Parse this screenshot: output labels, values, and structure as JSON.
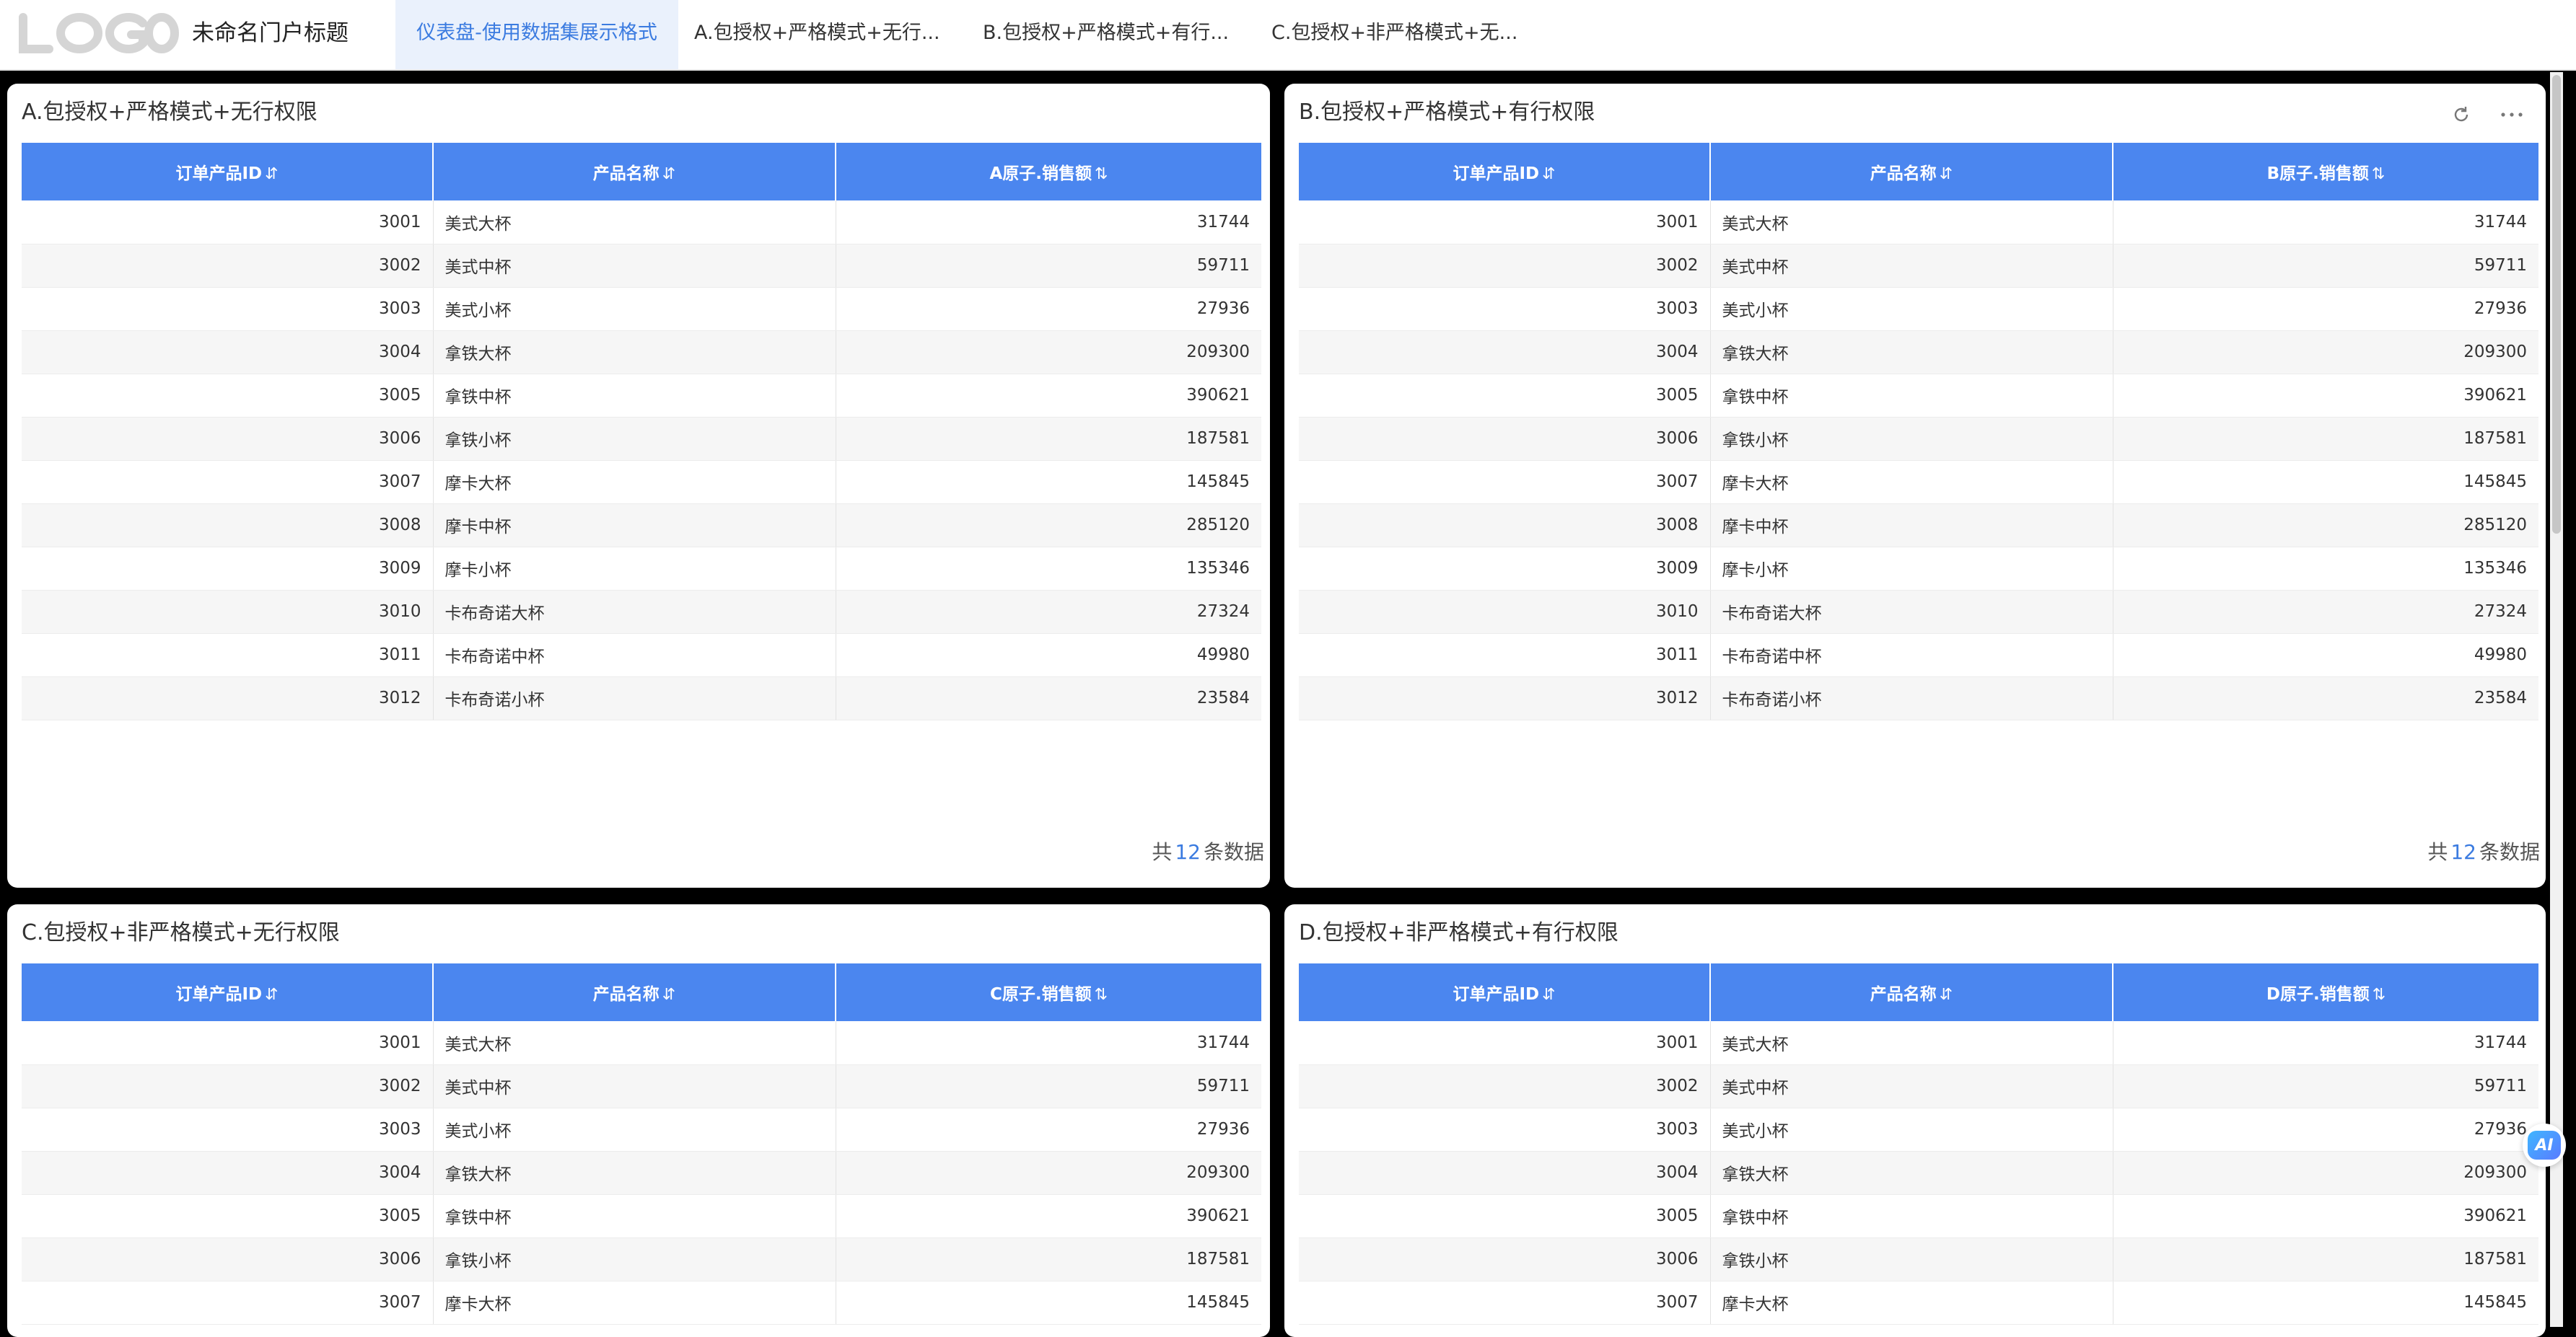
{
  "header": {
    "logo_text": "LOGO",
    "portal_title": "未命名门户标题",
    "tabs": [
      {
        "label": "仪表盘-使用数据集展示格式",
        "active": true
      },
      {
        "label": "A.包授权+严格模式+无行...",
        "active": false
      },
      {
        "label": "B.包授权+严格模式+有行...",
        "active": false
      },
      {
        "label": "C.包授权+非严格模式+无...",
        "active": false
      }
    ]
  },
  "colors": {
    "accent": "#3b7be0",
    "table_header": "#4b86ef",
    "tab_active_bg": "#eaf1fc"
  },
  "panels": {
    "a": {
      "title": "A.包授权+严格模式+无行权限",
      "columns": [
        "订单产品ID",
        "产品名称",
        "A原子.销售额"
      ],
      "footer": {
        "prefix": "共",
        "count": "12",
        "suffix": "条数据"
      }
    },
    "b": {
      "title": "B.包授权+严格模式+有行权限",
      "columns": [
        "订单产品ID",
        "产品名称",
        "B原子.销售额"
      ],
      "footer": {
        "prefix": "共",
        "count": "12",
        "suffix": "条数据"
      },
      "tools": [
        "refresh-icon",
        "more-icon"
      ]
    },
    "c": {
      "title": "C.包授权+非严格模式+无行权限",
      "columns": [
        "订单产品ID",
        "产品名称",
        "C原子.销售额"
      ]
    },
    "d": {
      "title": "D.包授权+非严格模式+有行权限",
      "columns": [
        "订单产品ID",
        "产品名称",
        "D原子.销售额"
      ]
    }
  },
  "rows": [
    {
      "id": "3001",
      "name": "美式大杯",
      "sales": "31744"
    },
    {
      "id": "3002",
      "name": "美式中杯",
      "sales": "59711"
    },
    {
      "id": "3003",
      "name": "美式小杯",
      "sales": "27936"
    },
    {
      "id": "3004",
      "name": "拿铁大杯",
      "sales": "209300"
    },
    {
      "id": "3005",
      "name": "拿铁中杯",
      "sales": "390621"
    },
    {
      "id": "3006",
      "name": "拿铁小杯",
      "sales": "187581"
    },
    {
      "id": "3007",
      "name": "摩卡大杯",
      "sales": "145845"
    },
    {
      "id": "3008",
      "name": "摩卡中杯",
      "sales": "285120"
    },
    {
      "id": "3009",
      "name": "摩卡小杯",
      "sales": "135346"
    },
    {
      "id": "3010",
      "name": "卡布奇诺大杯",
      "sales": "27324"
    },
    {
      "id": "3011",
      "name": "卡布奇诺中杯",
      "sales": "49980"
    },
    {
      "id": "3012",
      "name": "卡布奇诺小杯",
      "sales": "23584"
    }
  ],
  "visible_rows_bottom": 7,
  "sort_glyphs": {
    "asc": "⇅",
    "desc": "⇵"
  },
  "ai_badge": {
    "label": "AI"
  }
}
